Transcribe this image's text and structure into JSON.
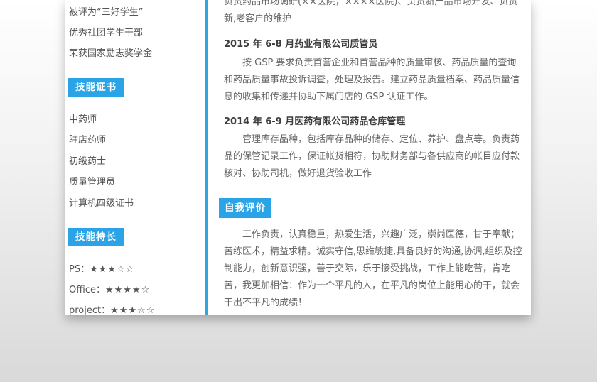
{
  "sidebar": {
    "honors": [
      "被评为“三好学生”",
      "优秀社团学生干部",
      "荣获国家励志奖学金"
    ],
    "certs_header": "技能证书",
    "certs": [
      "中药师",
      "驻店药师",
      "初级药士",
      "质量管理员",
      "计算机四级证书"
    ],
    "skills_header": "技能特长",
    "skills": [
      {
        "label": "PS：",
        "stars": "★★★☆☆"
      },
      {
        "label": "Office：",
        "stars": "★★★★☆"
      },
      {
        "label": "project：",
        "stars": "★★★☆☆"
      }
    ]
  },
  "main": {
    "top_para": "负责药品市场调研(××医院，××××医院)、负责新产品市场开发、负责新,老客户的维护",
    "jobs": [
      {
        "title": "2015 年 6-8 月药业有限公司质管员",
        "desc": "按 GSP 要求负责首营企业和首营品种的质量审核、药品质量的查询和药品质量事故投诉调查，处理及报告。建立药品质量档案、药品质量信息的收集和传递并协助下属门店的 GSP 认证工作。"
      },
      {
        "title": "2014 年 6-9 月医药有限公司药品仓库管理",
        "desc": "管理库存品种，包括库存品种的储存、定位、养护、盘点等。负责药品的保管记录工作，保证帐货相符，协助财务部与各供应商的帐目应付款核对、协助司机，做好退货验收工作"
      }
    ],
    "self_eval_header": "自我评价",
    "self_eval": "工作负责，认真稳重，热爱生活，兴趣广泛，崇尚医德，甘于奉献；苦练医术，精益求精。诚实守信,思维敏捷,具备良好的沟通,协调,组织及控制能力，创新意识强，善于交际，乐于接受挑战，工作上能吃苦，肯吃苦，我更加相信：作为一个平凡的人，在平凡的岗位上能用心的干，就会干出不平凡的成绩！"
  },
  "colors": {
    "accent": "#2aa4e6",
    "divider": "#2ea7e0"
  }
}
